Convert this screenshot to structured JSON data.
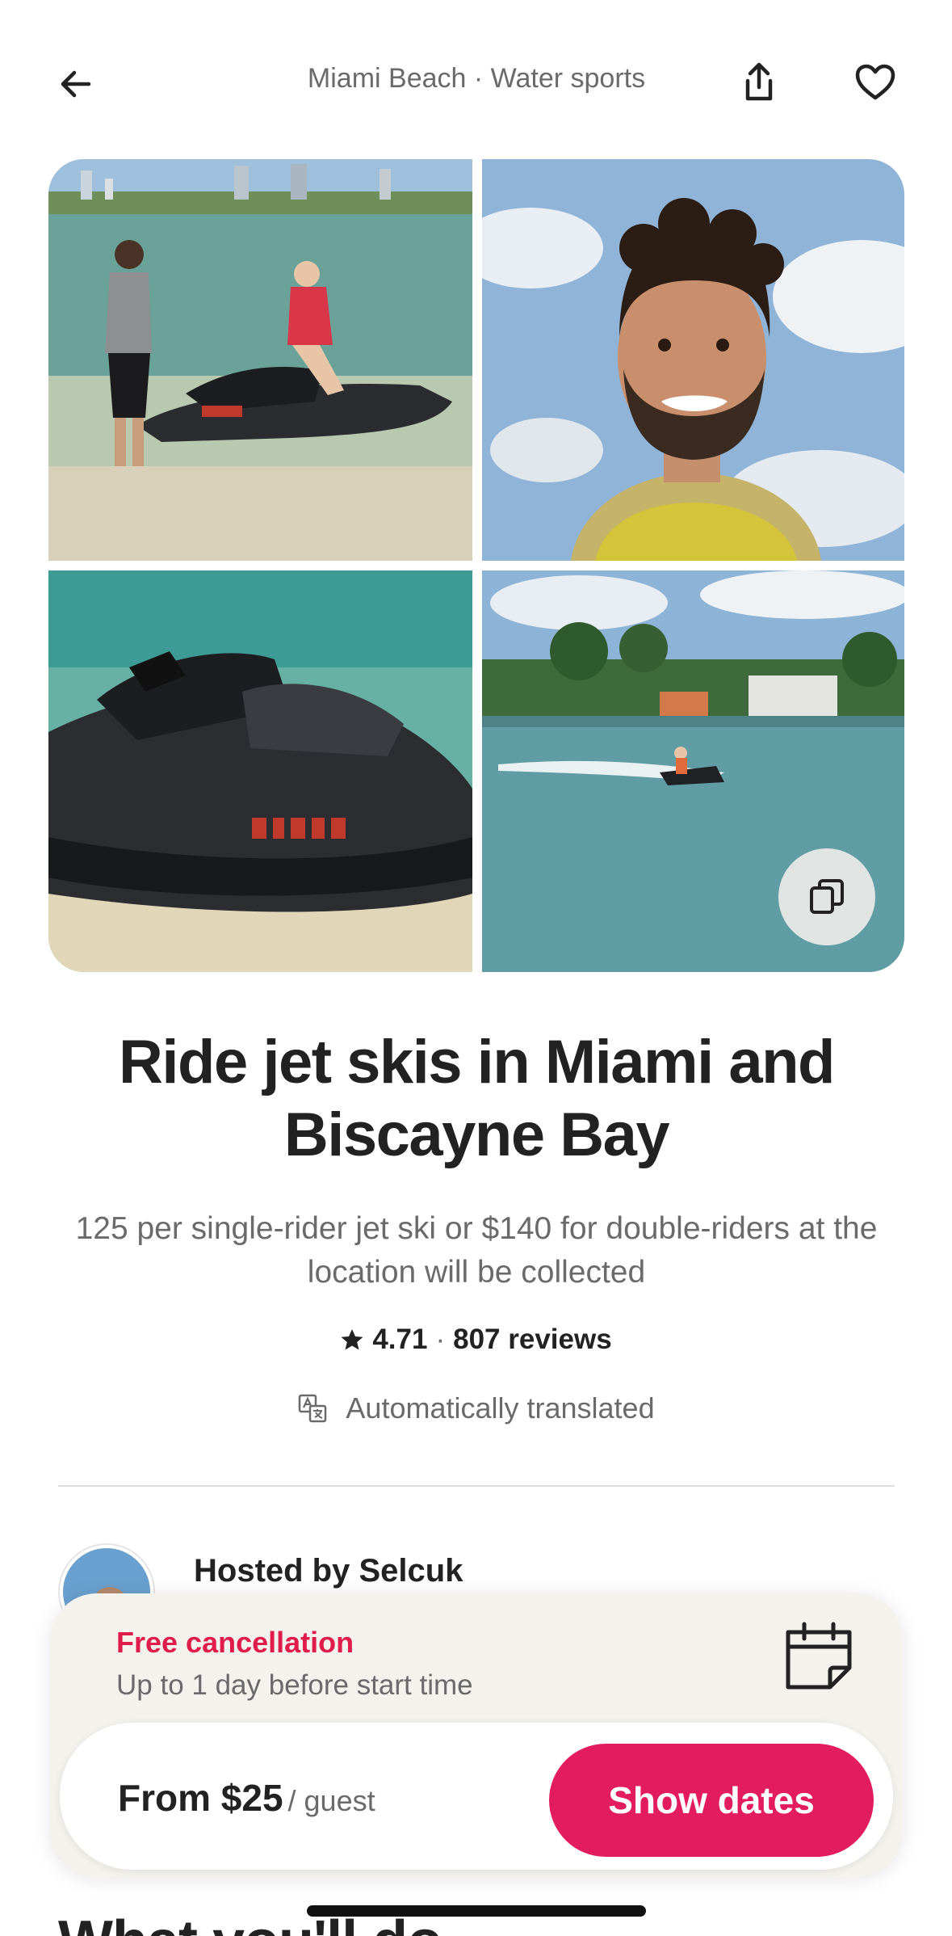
{
  "header": {
    "breadcrumb": "Miami Beach · Water sports",
    "icons": {
      "back": "arrow-left-icon",
      "share": "share-icon",
      "favorite": "heart-icon"
    }
  },
  "gallery": {
    "photos": [
      "jet-ski-instruction-photo",
      "host-portrait-photo",
      "jet-ski-closeup-photo",
      "jet-ski-riding-photo"
    ],
    "all_photos_icon": "copy-stack-icon"
  },
  "listing": {
    "title": "Ride jet skis in Miami and Biscayne Bay",
    "subtitle": "125 per single-rider jet ski or $140 for double-riders at the location will be collected",
    "rating": "4.71",
    "separator": "·",
    "reviews": "807 reviews",
    "translated_label": "Automatically translated"
  },
  "host": {
    "label": "Hosted by Selcuk"
  },
  "next_section": {
    "heading": "What you'll do"
  },
  "booking": {
    "cancel_title": "Free cancellation",
    "cancel_sub": "Up to 1 day before start time",
    "price": "From $25",
    "price_unit": "/ guest",
    "cta": "Show dates"
  },
  "colors": {
    "accent": "#e31c5f",
    "cancel_text": "#e01c4c",
    "text": "#222222",
    "muted": "#6a6a6a"
  }
}
